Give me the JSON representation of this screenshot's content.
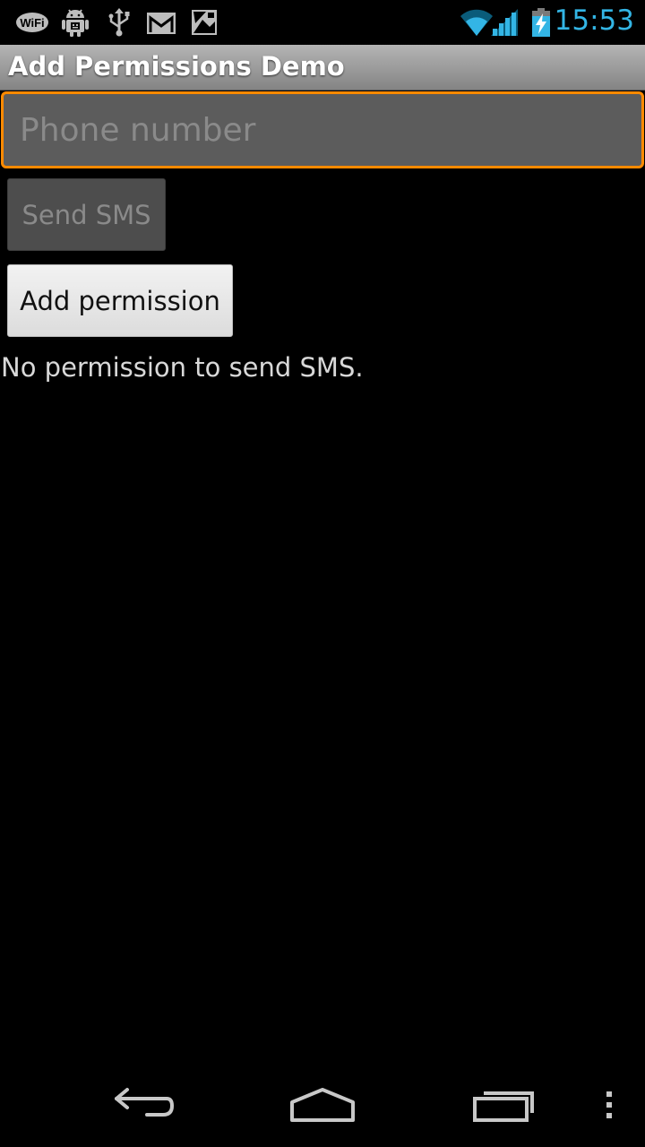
{
  "status_bar": {
    "time": "15:53",
    "wifi_badge_text": "WiFi",
    "icons": [
      "wifi-badge-icon",
      "android-debug-icon",
      "usb-icon",
      "gmail-icon",
      "photo-icon",
      "wifi-signal-icon",
      "cell-signal-icon",
      "battery-charging-icon"
    ],
    "clock_color": "#33b5e5"
  },
  "app_bar": {
    "title": "Add Permissions Demo"
  },
  "form": {
    "phone_placeholder": "Phone number",
    "phone_value": "",
    "send_sms_label": "Send SMS",
    "add_permission_label": "Add permission",
    "status_message": "No permission to send SMS."
  },
  "nav_bar": {
    "icons": [
      "back-icon",
      "home-icon",
      "recent-apps-icon",
      "overflow-menu-icon"
    ]
  },
  "colors": {
    "focus_border": "#ff8a00",
    "accent": "#33b5e5"
  }
}
